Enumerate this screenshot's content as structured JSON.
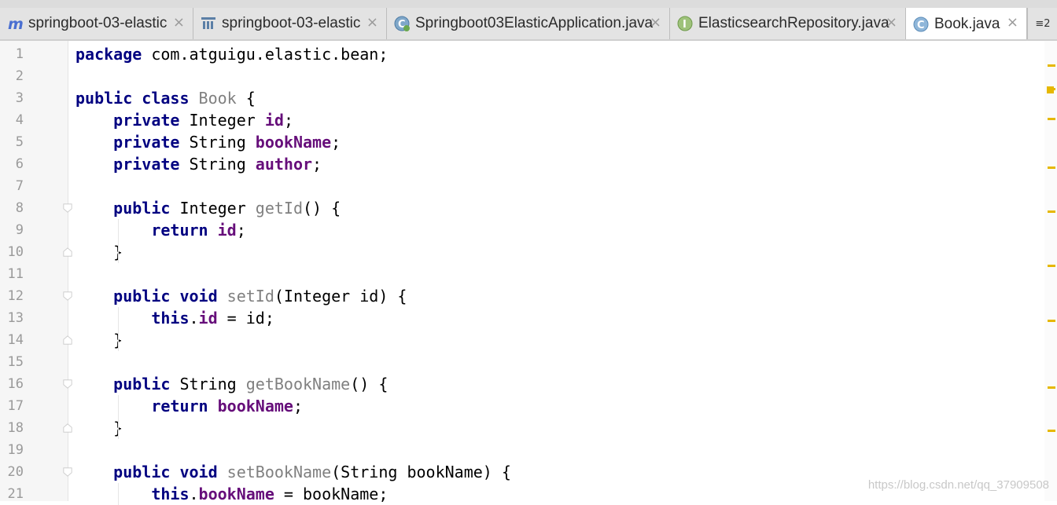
{
  "tabs": [
    {
      "label": "springboot-03-elastic",
      "icon": "maven-module-icon",
      "active": false
    },
    {
      "label": "springboot-03-elastic",
      "icon": "project-structure-icon",
      "active": false
    },
    {
      "label": "Springboot03ElasticApplication.java",
      "icon": "spring-class-icon",
      "active": false
    },
    {
      "label": "ElasticsearchRepository.java",
      "icon": "interface-icon",
      "active": false
    },
    {
      "label": "Book.java",
      "icon": "class-icon",
      "active": true
    }
  ],
  "tab_overflow_label": "≡2",
  "colors": {
    "keyword": "#000080",
    "field": "#660e7a",
    "unused_declaration": "#808080",
    "text": "#000000",
    "scroll_mark": "#e6b800"
  },
  "code_lines": [
    {
      "number": "1",
      "tokens": [
        {
          "t": "package",
          "c": "kw"
        },
        {
          "t": " com.atguigu.elastic.bean;",
          "c": "plain"
        }
      ]
    },
    {
      "number": "2",
      "tokens": []
    },
    {
      "number": "3",
      "tokens": [
        {
          "t": "public class ",
          "c": "kw"
        },
        {
          "t": "Book",
          "c": "decl"
        },
        {
          "t": " {",
          "c": "plain"
        }
      ]
    },
    {
      "number": "4",
      "tokens": [
        {
          "t": "    ",
          "c": "plain"
        },
        {
          "t": "private",
          "c": "kw"
        },
        {
          "t": " Integer ",
          "c": "plain"
        },
        {
          "t": "id",
          "c": "field"
        },
        {
          "t": ";",
          "c": "plain"
        }
      ]
    },
    {
      "number": "5",
      "tokens": [
        {
          "t": "    ",
          "c": "plain"
        },
        {
          "t": "private",
          "c": "kw"
        },
        {
          "t": " String ",
          "c": "plain"
        },
        {
          "t": "bookName",
          "c": "field"
        },
        {
          "t": ";",
          "c": "plain"
        }
      ]
    },
    {
      "number": "6",
      "tokens": [
        {
          "t": "    ",
          "c": "plain"
        },
        {
          "t": "private",
          "c": "kw"
        },
        {
          "t": " String ",
          "c": "plain"
        },
        {
          "t": "author",
          "c": "field"
        },
        {
          "t": ";",
          "c": "plain"
        }
      ]
    },
    {
      "number": "7",
      "tokens": []
    },
    {
      "number": "8",
      "tokens": [
        {
          "t": "    ",
          "c": "plain"
        },
        {
          "t": "public",
          "c": "kw"
        },
        {
          "t": " Integer ",
          "c": "plain"
        },
        {
          "t": "getId",
          "c": "decl"
        },
        {
          "t": "() {",
          "c": "plain"
        }
      ]
    },
    {
      "number": "9",
      "tokens": [
        {
          "t": "        ",
          "c": "plain"
        },
        {
          "t": "return",
          "c": "kw"
        },
        {
          "t": " ",
          "c": "plain"
        },
        {
          "t": "id",
          "c": "field"
        },
        {
          "t": ";",
          "c": "plain"
        }
      ]
    },
    {
      "number": "10",
      "tokens": [
        {
          "t": "    }",
          "c": "plain"
        }
      ]
    },
    {
      "number": "11",
      "tokens": []
    },
    {
      "number": "12",
      "tokens": [
        {
          "t": "    ",
          "c": "plain"
        },
        {
          "t": "public void",
          "c": "kw"
        },
        {
          "t": " ",
          "c": "plain"
        },
        {
          "t": "setId",
          "c": "decl"
        },
        {
          "t": "(Integer id) {",
          "c": "plain"
        }
      ]
    },
    {
      "number": "13",
      "tokens": [
        {
          "t": "        ",
          "c": "plain"
        },
        {
          "t": "this",
          "c": "kw"
        },
        {
          "t": ".",
          "c": "plain"
        },
        {
          "t": "id",
          "c": "field"
        },
        {
          "t": " = id;",
          "c": "plain"
        }
      ]
    },
    {
      "number": "14",
      "tokens": [
        {
          "t": "    }",
          "c": "plain"
        }
      ]
    },
    {
      "number": "15",
      "tokens": []
    },
    {
      "number": "16",
      "tokens": [
        {
          "t": "    ",
          "c": "plain"
        },
        {
          "t": "public",
          "c": "kw"
        },
        {
          "t": " String ",
          "c": "plain"
        },
        {
          "t": "getBookName",
          "c": "decl"
        },
        {
          "t": "() {",
          "c": "plain"
        }
      ]
    },
    {
      "number": "17",
      "tokens": [
        {
          "t": "        ",
          "c": "plain"
        },
        {
          "t": "return",
          "c": "kw"
        },
        {
          "t": " ",
          "c": "plain"
        },
        {
          "t": "bookName",
          "c": "field"
        },
        {
          "t": ";",
          "c": "plain"
        }
      ]
    },
    {
      "number": "18",
      "tokens": [
        {
          "t": "    }",
          "c": "plain"
        }
      ]
    },
    {
      "number": "19",
      "tokens": []
    },
    {
      "number": "20",
      "tokens": [
        {
          "t": "    ",
          "c": "plain"
        },
        {
          "t": "public void",
          "c": "kw"
        },
        {
          "t": " ",
          "c": "plain"
        },
        {
          "t": "setBookName",
          "c": "decl"
        },
        {
          "t": "(String bookName) {",
          "c": "plain"
        }
      ]
    },
    {
      "number": "21",
      "tokens": [
        {
          "t": "        ",
          "c": "plain"
        },
        {
          "t": "this",
          "c": "kw"
        },
        {
          "t": ".",
          "c": "plain"
        },
        {
          "t": "bookName",
          "c": "field"
        },
        {
          "t": " = bookName;",
          "c": "plain"
        }
      ]
    }
  ],
  "fold_marker_lines": [
    "8",
    "10",
    "12",
    "14",
    "16",
    "18",
    "20"
  ],
  "watermark": "https://blog.csdn.net/qq_37909508"
}
